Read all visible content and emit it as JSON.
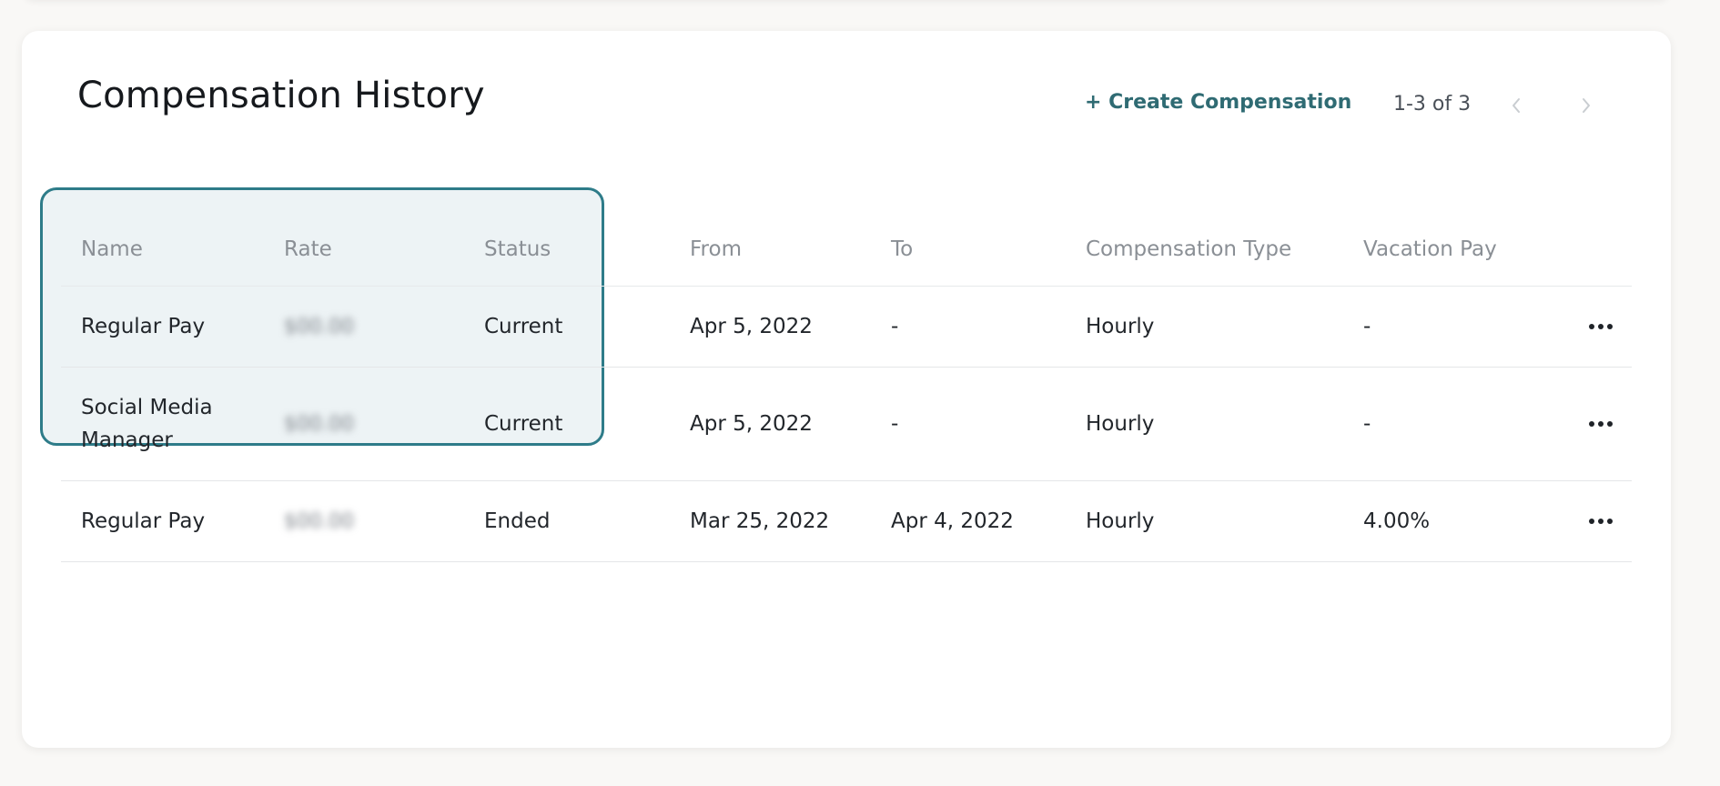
{
  "card": {
    "title": "Compensation History",
    "create_label": "+ Create Compensation",
    "pager_range": "1-3 of 3",
    "prev_icon": "chevron-left-icon",
    "next_icon": "chevron-right-icon"
  },
  "colors": {
    "accent": "#2f6b73",
    "highlight_border": "#2e7c89",
    "highlight_fill": "#edf3f5"
  },
  "table": {
    "columns": [
      "Name",
      "Rate",
      "Status",
      "From",
      "To",
      "Compensation Type",
      "Vacation Pay"
    ],
    "rows": [
      {
        "name": "Regular Pay",
        "rate": "$00.00",
        "status": "Current",
        "from": "Apr 5, 2022",
        "to": "-",
        "type": "Hourly",
        "vacation": "-"
      },
      {
        "name": "Social Media Manager",
        "rate": "$00.00",
        "status": "Current",
        "from": "Apr 5, 2022",
        "to": "-",
        "type": "Hourly",
        "vacation": "-"
      },
      {
        "name": "Regular Pay",
        "rate": "$00.00",
        "status": "Ended",
        "from": "Mar 25, 2022",
        "to": "Apr 4, 2022",
        "type": "Hourly",
        "vacation": "4.00%"
      }
    ]
  }
}
